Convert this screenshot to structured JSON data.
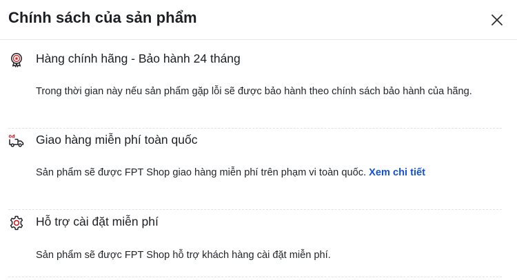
{
  "modal": {
    "title": "Chính sách của sản phẩm",
    "close_icon": "close-icon"
  },
  "policies": [
    {
      "icon": "genuine-badge-icon",
      "title": "Hàng chính hãng - Bảo hành 24 tháng",
      "description": "Trong thời gian này nếu sản phẩm gặp lỗi sẽ được bảo hành theo chính sách bảo hành của hãng."
    },
    {
      "icon": "free-delivery-truck-icon",
      "title": "Giao hàng miễn phí toàn quốc",
      "description": "Sản phẩm sẽ được FPT Shop giao hàng miễn phí trên phạm vi toàn quốc.",
      "link_text": "Xem chi tiết"
    },
    {
      "icon": "installation-gear-icon",
      "title": "Hỗ trợ cài đặt miễn phí",
      "description": "Sản phẩm sẽ được FPT Shop hỗ trợ khách hàng cài đặt miễn phí."
    }
  ],
  "colors": {
    "accent_red": "#cb1c22",
    "link_blue": "#1250dc",
    "text": "#1c1f23",
    "divider": "#dfe2e6"
  }
}
